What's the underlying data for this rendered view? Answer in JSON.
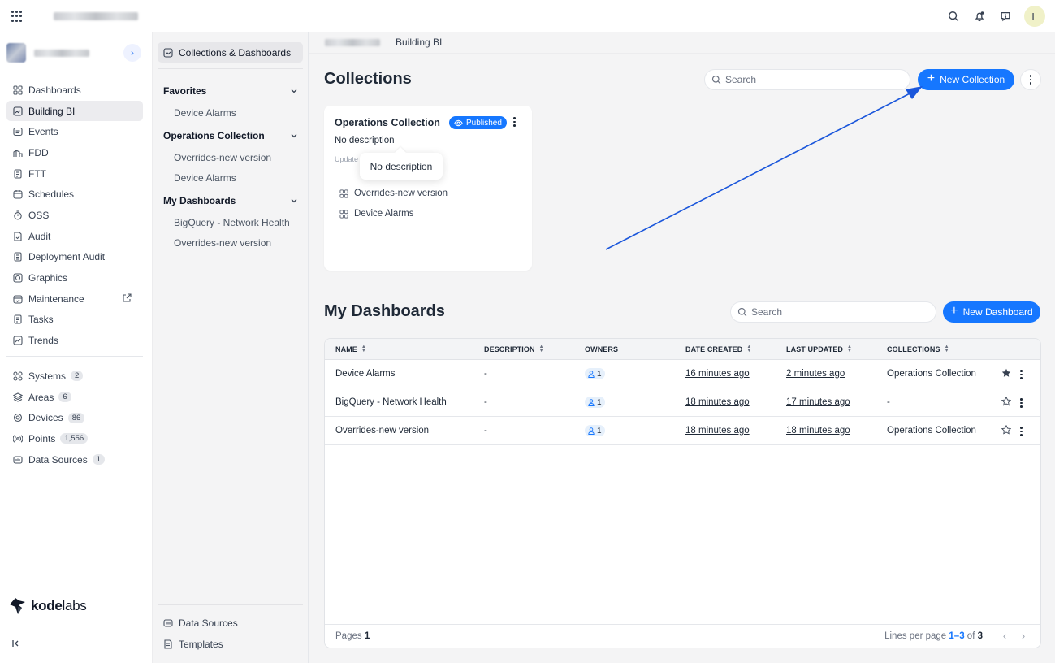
{
  "topbar": {
    "apps_icon": "grid-icon",
    "icons": [
      "search-icon",
      "bell-icon",
      "feedback-icon"
    ],
    "avatar_initial": "L"
  },
  "nav": {
    "items": [
      {
        "label": "Dashboards",
        "icon": "dashboards-icon"
      },
      {
        "label": "Building BI",
        "icon": "building-bi-icon",
        "active": true
      },
      {
        "label": "Events",
        "icon": "events-icon"
      },
      {
        "label": "FDD",
        "icon": "fdd-icon"
      },
      {
        "label": "FTT",
        "icon": "ftt-icon"
      },
      {
        "label": "Schedules",
        "icon": "calendar-icon"
      },
      {
        "label": "OSS",
        "icon": "timer-icon"
      },
      {
        "label": "Audit",
        "icon": "audit-icon"
      },
      {
        "label": "Deployment Audit",
        "icon": "deployment-audit-icon"
      },
      {
        "label": "Graphics",
        "icon": "graphics-icon"
      },
      {
        "label": "Maintenance",
        "icon": "maintenance-icon"
      },
      {
        "label": "Tasks",
        "icon": "tasks-icon"
      },
      {
        "label": "Trends",
        "icon": "trends-icon"
      }
    ],
    "counted": [
      {
        "label": "Systems",
        "count": "2"
      },
      {
        "label": "Areas",
        "count": "6"
      },
      {
        "label": "Devices",
        "count": "86"
      },
      {
        "label": "Points",
        "count": "1,556"
      },
      {
        "label": "Data Sources",
        "count": "1"
      }
    ],
    "brand": {
      "bold": "kode",
      "light": "labs"
    }
  },
  "bi_nav": {
    "active": "Collections & Dashboards",
    "groups": [
      {
        "title": "Favorites",
        "links": [
          "Device Alarms"
        ]
      },
      {
        "title": "Operations Collection",
        "links": [
          "Overrides-new version",
          "Device Alarms"
        ]
      },
      {
        "title": "My Dashboards",
        "links": [
          "BigQuery - Network Health",
          "Overrides-new version"
        ]
      }
    ],
    "bottom": [
      "Data Sources",
      "Templates"
    ]
  },
  "breadcrumb": {
    "current": "Building BI"
  },
  "collections": {
    "title": "Collections",
    "search_placeholder": "Search",
    "new_button": "New Collection",
    "card": {
      "title": "Operations Collection",
      "badge": "Published",
      "description": "No description",
      "updated": "Update",
      "items": [
        "Overrides-new version",
        "Device Alarms"
      ]
    },
    "tooltip": "No description"
  },
  "dashboards": {
    "title": "My Dashboards",
    "search_placeholder": "Search",
    "new_button": "New Dashboard",
    "columns": [
      "NAME",
      "DESCRIPTION",
      "OWNERS",
      "DATE CREATED",
      "LAST UPDATED",
      "COLLECTIONS"
    ],
    "rows": [
      {
        "name": "Device Alarms",
        "description": "-",
        "owners": "1",
        "created": "16 minutes ago",
        "updated": "2 minutes ago",
        "collection": "Operations Collection",
        "starred": true
      },
      {
        "name": "BigQuery - Network Health",
        "description": "-",
        "owners": "1",
        "created": "18 minutes ago",
        "updated": "17 minutes ago",
        "collection": "-",
        "starred": false
      },
      {
        "name": "Overrides-new version",
        "description": "-",
        "owners": "1",
        "created": "18 minutes ago",
        "updated": "18 minutes ago",
        "collection": "Operations Collection",
        "starred": false
      }
    ],
    "footer": {
      "pages_label": "Pages",
      "pages_value": "1",
      "lines_label": "Lines per page",
      "range": "1–3",
      "of": "of",
      "total": "3"
    }
  },
  "colors": {
    "accent": "#1677ff",
    "annotation_arrow": "#1a56db"
  }
}
